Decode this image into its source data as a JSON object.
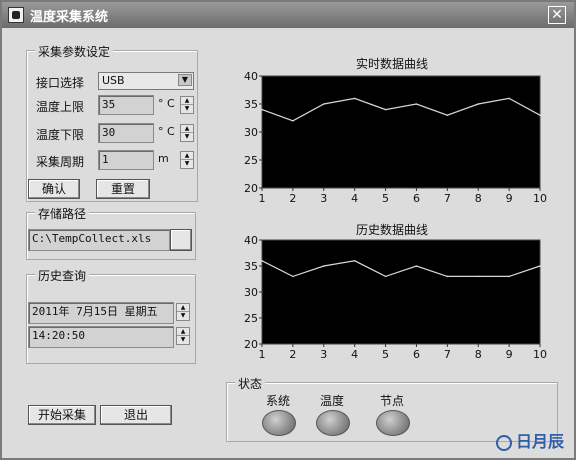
{
  "window": {
    "title": "温度采集系统",
    "close_glyph": "✕"
  },
  "params": {
    "group_title": "采集参数设定",
    "interface_label": "接口选择",
    "interface_value": "USB",
    "upper_label": "温度上限",
    "upper_value": "35",
    "upper_unit": "° C",
    "lower_label": "温度下限",
    "lower_value": "30",
    "lower_unit": "° C",
    "period_label": "采集周期",
    "period_value": "1",
    "period_unit": "m",
    "confirm_label": "确认",
    "reset_label": "重置"
  },
  "storage": {
    "group_title": "存储路径",
    "path_value": "C:\\TempCollect.xls"
  },
  "history": {
    "group_title": "历史查询",
    "date_value": "2011年 7月15日  星期五",
    "time_value": "14:20:50"
  },
  "actions": {
    "start_label": "开始采集",
    "exit_label": "退出"
  },
  "status": {
    "group_title": "状态",
    "leds": [
      "系统",
      "温度",
      "节点"
    ]
  },
  "charts_text": {
    "realtime_title": "实时数据曲线",
    "history_title": "历史数据曲线"
  },
  "watermark": "日月辰",
  "chart_data": [
    {
      "type": "line",
      "title": "实时数据曲线",
      "x": [
        1,
        2,
        3,
        4,
        5,
        6,
        7,
        8,
        9,
        10
      ],
      "series": [
        {
          "values": [
            34,
            32,
            35,
            36,
            34,
            35,
            33,
            35,
            36,
            33
          ]
        }
      ],
      "xlim": [
        1,
        10
      ],
      "ylim": [
        20,
        40
      ],
      "yticks": [
        20,
        25,
        30,
        35,
        40
      ],
      "grid": false,
      "background": "#000000",
      "line_color": "#d8d8d8"
    },
    {
      "type": "line",
      "title": "历史数据曲线",
      "x": [
        1,
        2,
        3,
        4,
        5,
        6,
        7,
        8,
        9,
        10
      ],
      "series": [
        {
          "values": [
            36,
            33,
            35,
            36,
            33,
            35,
            33,
            33,
            33,
            35
          ]
        }
      ],
      "xlim": [
        1,
        10
      ],
      "ylim": [
        20,
        40
      ],
      "yticks": [
        20,
        25,
        30,
        35,
        40
      ],
      "grid": false,
      "background": "#000000",
      "line_color": "#d8d8d8"
    }
  ]
}
